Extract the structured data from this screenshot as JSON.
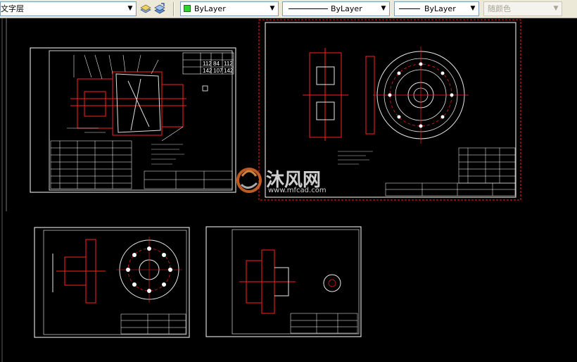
{
  "toolbar": {
    "text_style": "文字层",
    "color": {
      "label": "ByLayer",
      "swatch": "#2ed52e"
    },
    "linetype": {
      "label": "ByLayer"
    },
    "lineweight": {
      "label": "ByLayer"
    },
    "plot_style": {
      "label": "随颜色"
    }
  },
  "watermark": {
    "brand": "沐风网",
    "url": "www.mfcad.com"
  },
  "drawings": {
    "sheet1_table_values": [
      "112",
      "84",
      "112",
      "142",
      "107",
      "142"
    ]
  },
  "colors": {
    "canvas": "#000000",
    "frame": "#ffffff",
    "red": "#ff2020",
    "white_line": "#e8e8e8",
    "watermark_accent": "#e06a2a"
  }
}
